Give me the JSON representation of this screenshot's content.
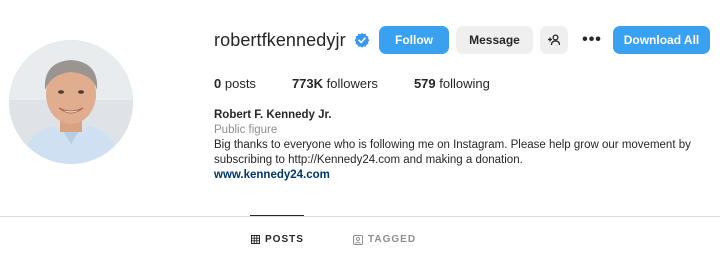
{
  "profile": {
    "username": "robertfkennedyjr",
    "verified_icon": "verified-badge-icon",
    "accent_color": "#3aa0f0"
  },
  "actions": {
    "follow_label": "Follow",
    "message_label": "Message",
    "suggest_icon": "add-person-icon",
    "more_label": "•••",
    "download_label": "Download All"
  },
  "stats": {
    "posts_count": "0",
    "posts_label": "posts",
    "followers_count": "773K",
    "followers_label": "followers",
    "following_count": "579",
    "following_label": "following"
  },
  "bio": {
    "name": "Robert F. Kennedy Jr.",
    "category": "Public figure",
    "text": "Big thanks to everyone who is following me on Instagram. Please help grow our movement by subscribing to http://Kennedy24.com and making a donation.",
    "link": "www.kennedy24.com"
  },
  "tabs": [
    {
      "label": "POSTS",
      "icon": "grid-icon",
      "active": true
    },
    {
      "label": "TAGGED",
      "icon": "tag-icon",
      "active": false
    }
  ]
}
